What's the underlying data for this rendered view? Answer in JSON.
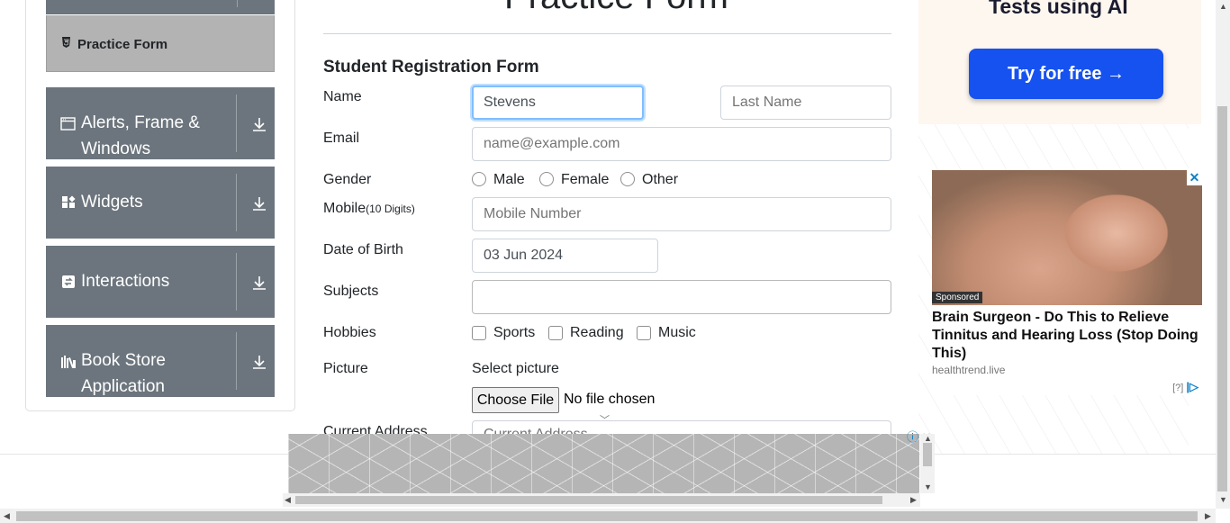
{
  "sidebar": {
    "active_item": {
      "label": "Practice Form",
      "icon": "html5-icon"
    },
    "groups": [
      {
        "label": "Alerts, Frame & Windows",
        "icon": "window-icon"
      },
      {
        "label": "Widgets",
        "icon": "widgets-icon"
      },
      {
        "label": "Interactions",
        "icon": "interactions-icon"
      },
      {
        "label": "Book Store Application",
        "icon": "books-icon"
      }
    ]
  },
  "form": {
    "page_title": "Practice Form",
    "title": "Student Registration Form",
    "name_label": "Name",
    "first_name_value": "Stevens",
    "last_name_placeholder": "Last Name",
    "email_label": "Email",
    "email_placeholder": "name@example.com",
    "gender_label": "Gender",
    "gender_options": [
      "Male",
      "Female",
      "Other"
    ],
    "mobile_label": "Mobile",
    "mobile_hint": "(10 Digits)",
    "mobile_placeholder": "Mobile Number",
    "dob_label": "Date of Birth",
    "dob_value": "03 Jun 2024",
    "subjects_label": "Subjects",
    "hobbies_label": "Hobbies",
    "hobbies_options": [
      "Sports",
      "Reading",
      "Music"
    ],
    "picture_label": "Picture",
    "select_picture": "Select picture",
    "choose_file": "Choose File",
    "file_status": "No file chosen",
    "address_label": "Current Address",
    "address_placeholder": "Current Address"
  },
  "ads": {
    "top_headline": "Tests using AI",
    "top_cta": "Try for free →",
    "sponsored": "Sponsored",
    "headline": "Brain Surgeon - Do This to Relieve Tinnitus and Hearing Loss (Stop Doing This)",
    "domain": "healthtrend.live",
    "help": "[?]"
  },
  "colors": {
    "sidebar_group": "#6c757d",
    "sidebar_active": "#b3b3b3",
    "focus_border": "#80bdff",
    "cta_blue": "#1652f0"
  }
}
